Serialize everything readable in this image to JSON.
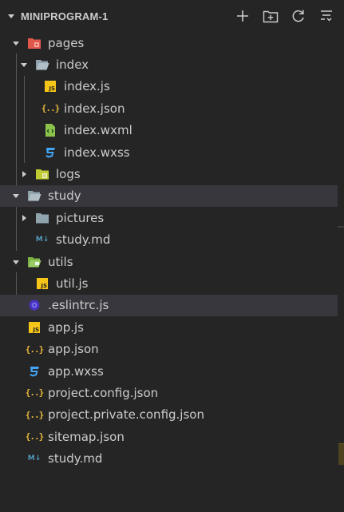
{
  "explorer": {
    "title": "MINIPROGRAM-1",
    "actions": [
      {
        "name": "new-file-icon",
        "label": "New File"
      },
      {
        "name": "new-folder-icon",
        "label": "New Folder"
      },
      {
        "name": "refresh-icon",
        "label": "Refresh Explorer"
      },
      {
        "name": "collapse-all-icon",
        "label": "Collapse Folders in Explorer"
      }
    ]
  },
  "tree": [
    {
      "label": "pages",
      "kind": "folder",
      "icon": "pages-folder-icon",
      "expanded": true,
      "depth": 1
    },
    {
      "label": "index",
      "kind": "folder",
      "icon": "folder-open-icon",
      "expanded": true,
      "depth": 2
    },
    {
      "label": "index.js",
      "kind": "file",
      "icon": "js-file-icon",
      "depth": 3
    },
    {
      "label": "index.json",
      "kind": "file",
      "icon": "json-file-icon",
      "depth": 3
    },
    {
      "label": "index.wxml",
      "kind": "file",
      "icon": "wxml-file-icon",
      "depth": 3
    },
    {
      "label": "index.wxss",
      "kind": "file",
      "icon": "css-file-icon",
      "depth": 3
    },
    {
      "label": "logs",
      "kind": "folder",
      "icon": "logs-folder-icon",
      "expanded": false,
      "depth": 2
    },
    {
      "label": "study",
      "kind": "folder",
      "icon": "folder-open-icon",
      "expanded": true,
      "depth": 1,
      "selected": true
    },
    {
      "label": "pictures",
      "kind": "folder",
      "icon": "folder-icon",
      "expanded": false,
      "depth": 2
    },
    {
      "label": "study.md",
      "kind": "file",
      "icon": "markdown-file-icon",
      "depth": 2
    },
    {
      "label": "utils",
      "kind": "folder",
      "icon": "utils-folder-icon",
      "expanded": true,
      "depth": 1
    },
    {
      "label": "util.js",
      "kind": "file",
      "icon": "js-file-icon",
      "depth": 2
    },
    {
      "label": ".eslintrc.js",
      "kind": "file",
      "icon": "eslint-file-icon",
      "depth": 1,
      "selected": true
    },
    {
      "label": "app.js",
      "kind": "file",
      "icon": "js-file-icon",
      "depth": 1
    },
    {
      "label": "app.json",
      "kind": "file",
      "icon": "json-file-icon",
      "depth": 1
    },
    {
      "label": "app.wxss",
      "kind": "file",
      "icon": "css-file-icon",
      "depth": 1
    },
    {
      "label": "project.config.json",
      "kind": "file",
      "icon": "json-file-icon",
      "depth": 1
    },
    {
      "label": "project.private.config.json",
      "kind": "file",
      "icon": "json-file-icon",
      "depth": 1
    },
    {
      "label": "sitemap.json",
      "kind": "file",
      "icon": "json-file-icon",
      "depth": 1
    },
    {
      "label": "study.md",
      "kind": "file",
      "icon": "markdown-file-icon",
      "depth": 1
    }
  ],
  "colors": {
    "background": "#252526",
    "selected_row": "#37373d",
    "text": "#cccccc",
    "js": "#f5c518",
    "json": "#e8b93a",
    "css": "#42a5f5",
    "markdown": "#519aba"
  }
}
